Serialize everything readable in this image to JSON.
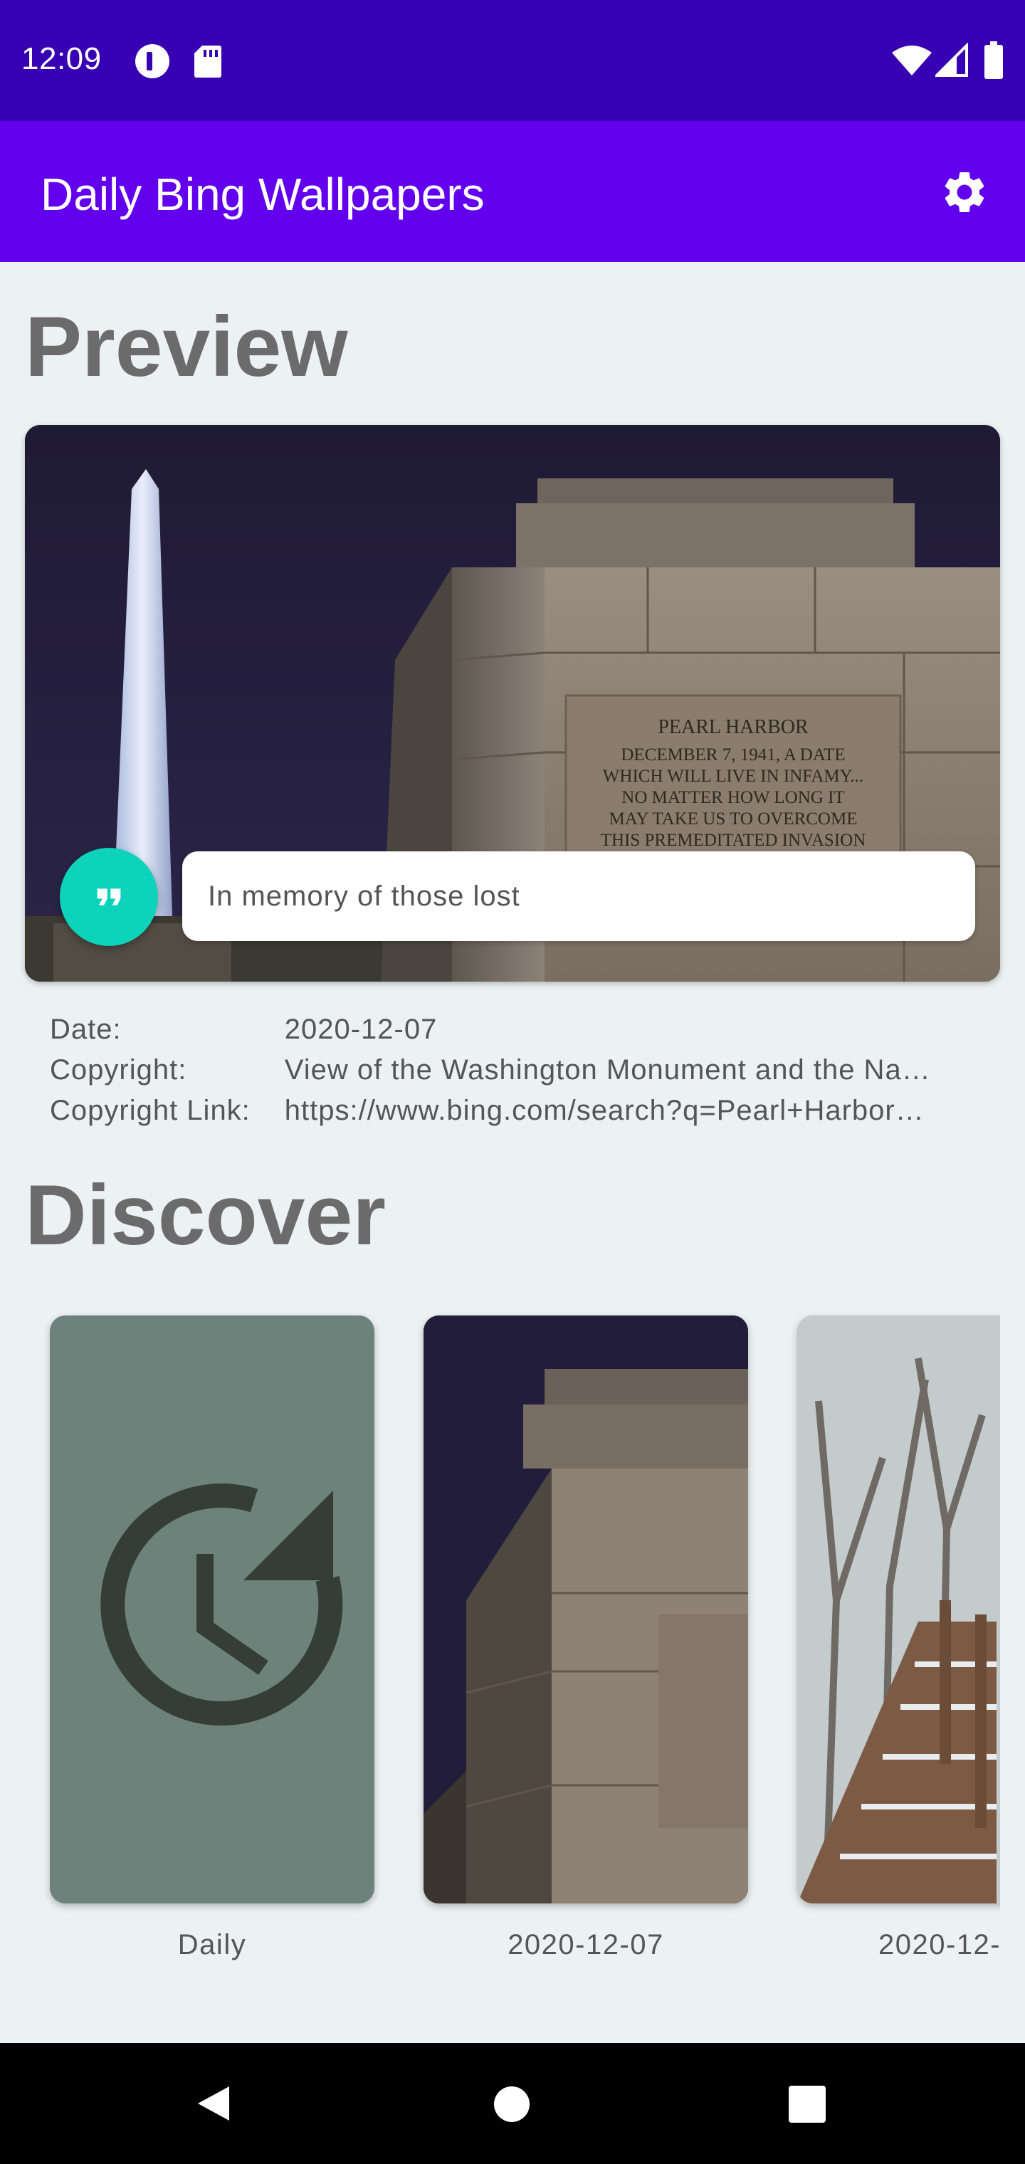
{
  "status_bar": {
    "time": "12:09",
    "left_icons": [
      "alpha-circle-icon",
      "sd-card-icon"
    ],
    "right_icons": [
      "wifi-icon",
      "cell-signal-icon",
      "battery-icon"
    ]
  },
  "app_bar": {
    "title": "Daily Bing Wallpapers",
    "settings_icon": "gear-icon"
  },
  "preview": {
    "heading": "Preview",
    "image_inscription": [
      "PEARL HARBOR",
      "DECEMBER 7, 1941, A DATE",
      "WHICH WILL LIVE IN INFAMY...",
      "NO MATTER HOW LONG IT",
      "MAY TAKE US TO OVERCOME",
      "THIS PREMEDITATED INVASION"
    ],
    "quote_icon": "format-quote-icon",
    "caption": "In memory of those lost"
  },
  "metadata": {
    "rows": [
      {
        "label": "Date:",
        "value": "2020-12-07"
      },
      {
        "label": "Copyright:",
        "value": "View of the Washington Monument and the Na…"
      },
      {
        "label": "Copyright Link:",
        "value": "https://www.bing.com/search?q=Pearl+Harbor…"
      }
    ]
  },
  "discover": {
    "heading": "Discover",
    "items": [
      {
        "label": "Daily",
        "icon": "history-refresh-icon",
        "color": "#6E827C"
      },
      {
        "label": "2020-12-07"
      },
      {
        "label": "2020-12-"
      }
    ]
  },
  "nav_bar": {
    "icons": [
      "back-triangle-icon",
      "home-circle-icon",
      "recents-square-icon"
    ]
  },
  "colors": {
    "status_bar": "#3700B3",
    "app_bar": "#6200EE",
    "background": "#ECF1F1",
    "accent": "#0DD3BB",
    "heading": "#6B6B6B"
  }
}
